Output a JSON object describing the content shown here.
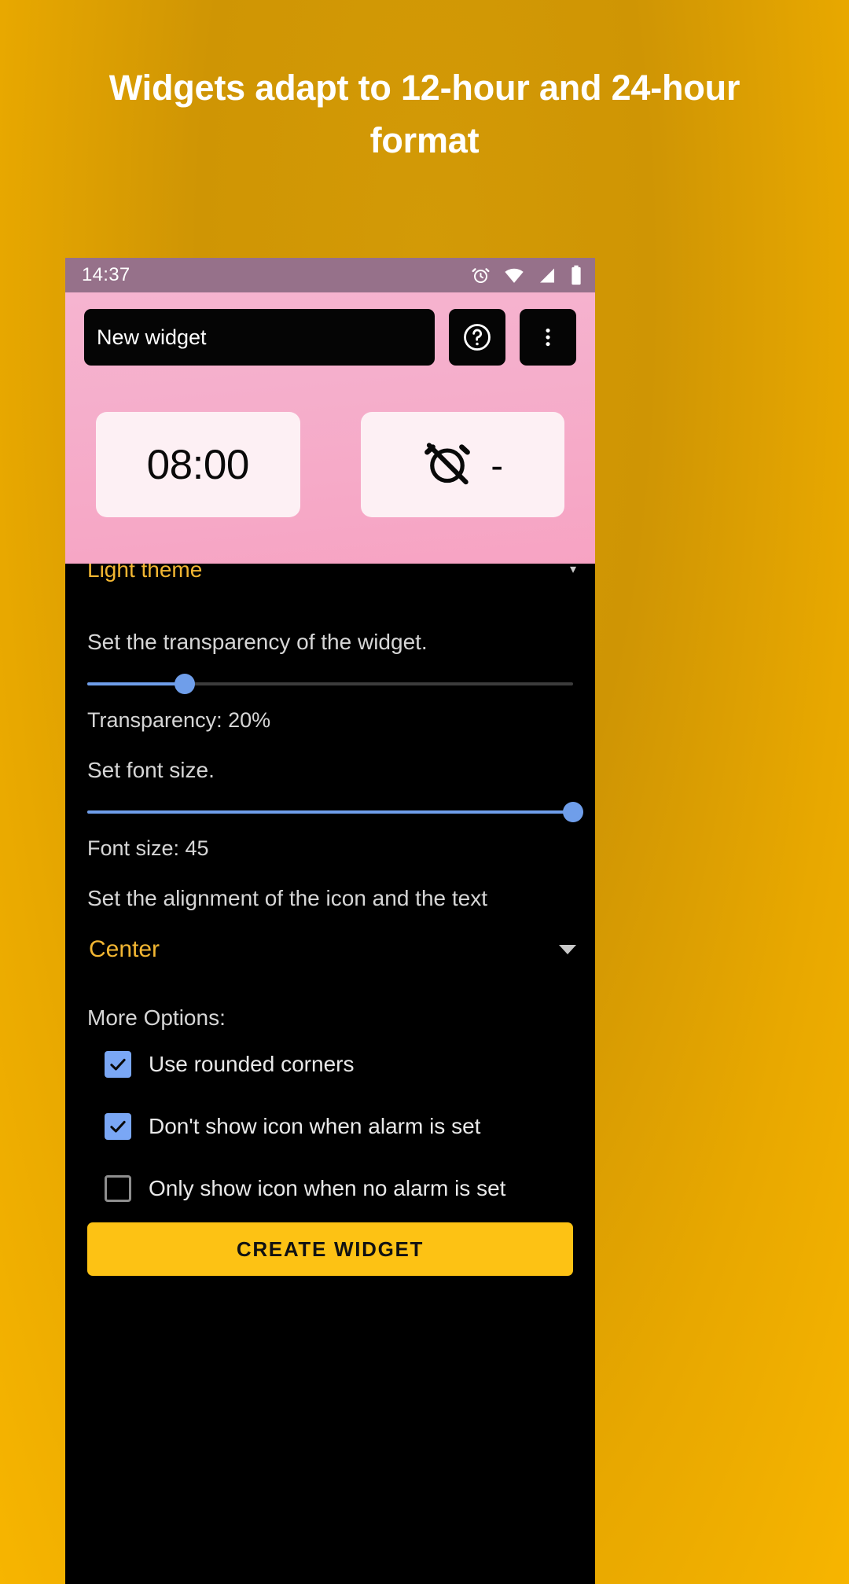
{
  "headline": "Widgets adapt to 12-hour and 24-hour format",
  "statusbar": {
    "time": "14:37",
    "icons": [
      "alarm-icon",
      "wifi-icon",
      "signal-icon",
      "battery-icon"
    ]
  },
  "widget_editor": {
    "name_value": "New widget",
    "name_placeholder": "New widget",
    "help_icon": "help-circle-icon",
    "overflow_icon": "more-vertical-icon",
    "preview_cards": [
      {
        "type": "time",
        "value": "08:00"
      },
      {
        "type": "alarm_off",
        "icon": "alarm-off-icon",
        "value": "-"
      }
    ]
  },
  "settings": {
    "theme_value": "Light theme",
    "transparency_label": "Set the transparency of the widget.",
    "transparency_value_text": "Transparency: 20%",
    "transparency_percent": 20,
    "font_size_label": "Set font size.",
    "font_size_value_text": "Font size: 45",
    "font_size_percent": 100,
    "alignment_label": "Set the alignment of the icon and the text",
    "alignment_value": "Center",
    "more_options_label": "More Options:",
    "options": [
      {
        "label": "Use rounded corners",
        "checked": true
      },
      {
        "label": "Don't show icon when alarm is set",
        "checked": true
      },
      {
        "label": "Only show icon when no alarm is set",
        "checked": false
      }
    ],
    "create_button": "CREATE WIDGET"
  },
  "colors": {
    "background": "#d39a06",
    "accent_yellow": "#fdc214",
    "slider_blue": "#6f9eea",
    "checkbox_blue": "#7aa7f5",
    "preview_pink": "#f6aecb",
    "dropdown_yellow": "#f2b632"
  }
}
